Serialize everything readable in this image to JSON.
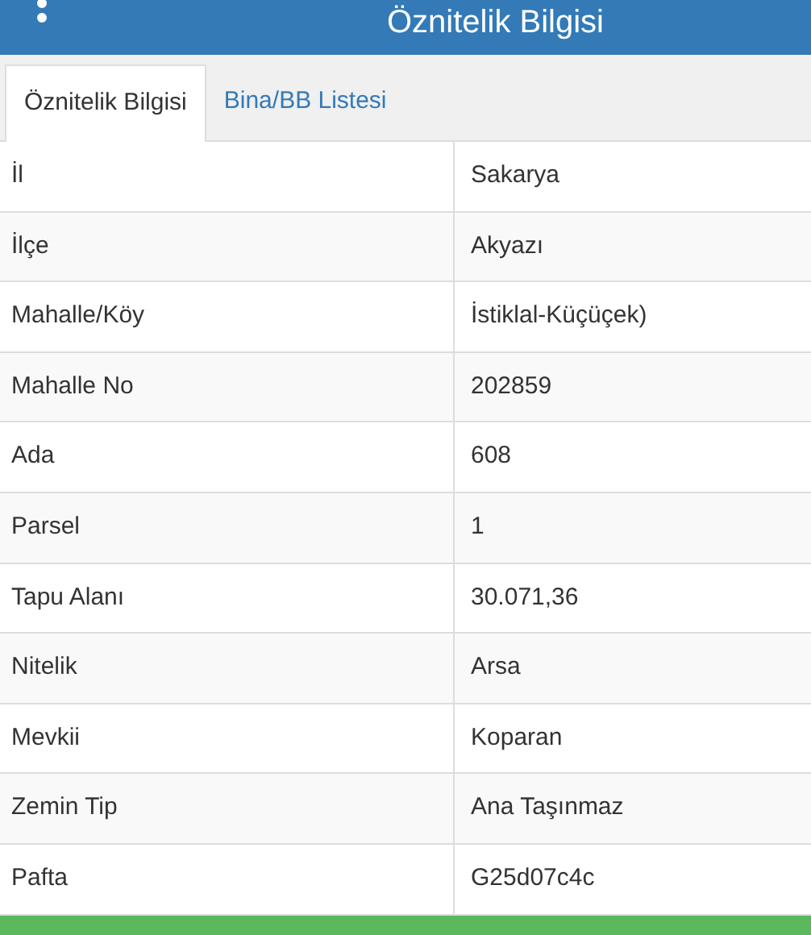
{
  "header": {
    "title": "Öznitelik Bilgisi"
  },
  "tabs": [
    {
      "label": "Öznitelik Bilgisi",
      "selected": true
    },
    {
      "label": "Bina/BB Listesi",
      "selected": false
    }
  ],
  "table": {
    "rows": [
      {
        "label": "İl",
        "value": "Sakarya"
      },
      {
        "label": "İlçe",
        "value": "Akyazı"
      },
      {
        "label": "Mahalle/Köy",
        "value": "İstiklal-Küçüçek)"
      },
      {
        "label": "Mahalle No",
        "value": "202859"
      },
      {
        "label": "Ada",
        "value": "608"
      },
      {
        "label": "Parsel",
        "value": "1"
      },
      {
        "label": "Tapu Alanı",
        "value": "30.071,36"
      },
      {
        "label": "Nitelik",
        "value": "Arsa"
      },
      {
        "label": "Mevkii",
        "value": "Koparan"
      },
      {
        "label": "Zemin Tip",
        "value": "Ana Taşınmaz"
      },
      {
        "label": "Pafta",
        "value": "G25d07c4c"
      }
    ]
  }
}
